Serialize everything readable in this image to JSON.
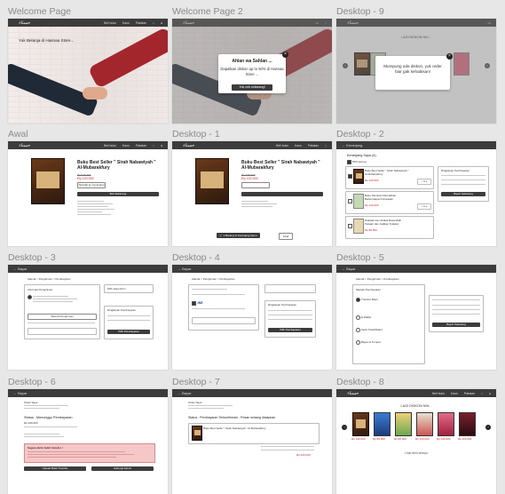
{
  "frames": {
    "welcome": {
      "label": "Welcome Page",
      "hero_text": "Yuk Belanja di Hasnaa Store...",
      "nav": [
        "Beli buku",
        "Kaos",
        "Pakaian"
      ]
    },
    "welcome2": {
      "label": "Welcome Page 2",
      "popup_title": "Ahlan wa Sahlan ...",
      "popup_body": "Dapatkan diskon up to 50% di Hasnaa Store ...",
      "popup_btn": "Yuk cek sekarang!"
    },
    "d9": {
      "label": "Desktop - 9",
      "popup_body": "Mumpung ada diskon, yuk order biar gak kehabisan!",
      "heading": "LAGI DISKON NIH..."
    },
    "awal": {
      "label": "Awal",
      "title": "Buku Best Seller \" Sirah Nabawiyah \" Al-Mubarakfury",
      "price_old": "Rp 215.000",
      "price": "Rp 120.000",
      "btn_outline": "Tambah ke Keranjang",
      "btn_dark": "Beli Sekarang"
    },
    "d1": {
      "label": "Desktop - 1",
      "title": "Buku Best Seller \" Sirah Nabawiyah \" Al-Mubarakfury",
      "price_old": "Rp 215.000",
      "price": "Rp 120.000",
      "toast": "1 Barang di Keranjang kamu",
      "toast_btn": "Lihat"
    },
    "d2": {
      "label": "Desktop - 2",
      "heading": "Keranjang Saya (4)",
      "select_all": "Pilih semua",
      "items": [
        {
          "name": "Buku Best Seller \" Sirah Nabawiyah \" Al-Mubarakfury",
          "price": "Rp 120.000",
          "qty": "1"
        },
        {
          "name": "Buku Panduan Ramadhan Berkemajuan Persiapan",
          "price": "Rp 140.000",
          "qty": "1"
        },
        {
          "name": "Dakwah dan Akhlak Rasulullah Pelajari dan Jadikan Teladan",
          "price": "Rp 80.000",
          "qty": "1"
        }
      ],
      "summary": "Ringkasan Pembayaran",
      "checkout": "Bayar Sekarang"
    },
    "d3": {
      "label": "Desktop - 3",
      "crumb": "Alamat > Pengiriman > Pembayaran",
      "addr_title": "Informasi Pengiriman",
      "addr_btn": "Alamat Pengiriman",
      "ship": "Pilih Jasa Kirim",
      "summary": "Ringkasan Pembayaran",
      "pay_btn": "Pilih Pembayaran"
    },
    "d4": {
      "label": "Desktop - 4",
      "crumb": "Alamat > Pengiriman > Pembayaran",
      "summary": "Ringkasan Pembayaran",
      "pay_btn": "Pilih Pembayaran"
    },
    "d5": {
      "label": "Desktop - 5",
      "crumb": "Alamat > Pengiriman > Pembayaran",
      "methods": [
        "Metode Pembayaran",
        "Transfer Bank",
        "E-Wallet",
        "Kartu Kredit/Debit",
        "Bayar di Tempat"
      ],
      "pay_btn": "Bayar Sekarang"
    },
    "d6": {
      "label": "Desktop - 6",
      "order_id": "Order Saya",
      "status": "Status : Menunggu Pembayaran",
      "amount": "Rp 220.000",
      "warn_title": "Segera kirim bukti transfer !",
      "btn1": "Upload Bukti Transfer",
      "btn2": "Hubungi Admin"
    },
    "d7": {
      "label": "Desktop - 7",
      "order_id": "Order Saya",
      "status": "Status : Pembayaran Terkonfirmasi - Pesan sedang disiapkan",
      "item": "Buku Best Seller \" Sirah Nabawiyah \" Al-Mubarakfury",
      "total": "Rp 220.000"
    },
    "d8": {
      "label": "Desktop - 8",
      "heading": "LAGI DISKON NIH...",
      "prices": [
        "Rp 130.000",
        "Rp 85.000",
        "Rp 95.000",
        "Rp 120.000",
        "Rp 100.000",
        "Rp 110.000"
      ],
      "more": "Lihat lebih lainnya"
    }
  },
  "colors": {
    "navbar": "#3c3c3c",
    "accent_red": "#c22222",
    "background": "#e7e7e7"
  }
}
